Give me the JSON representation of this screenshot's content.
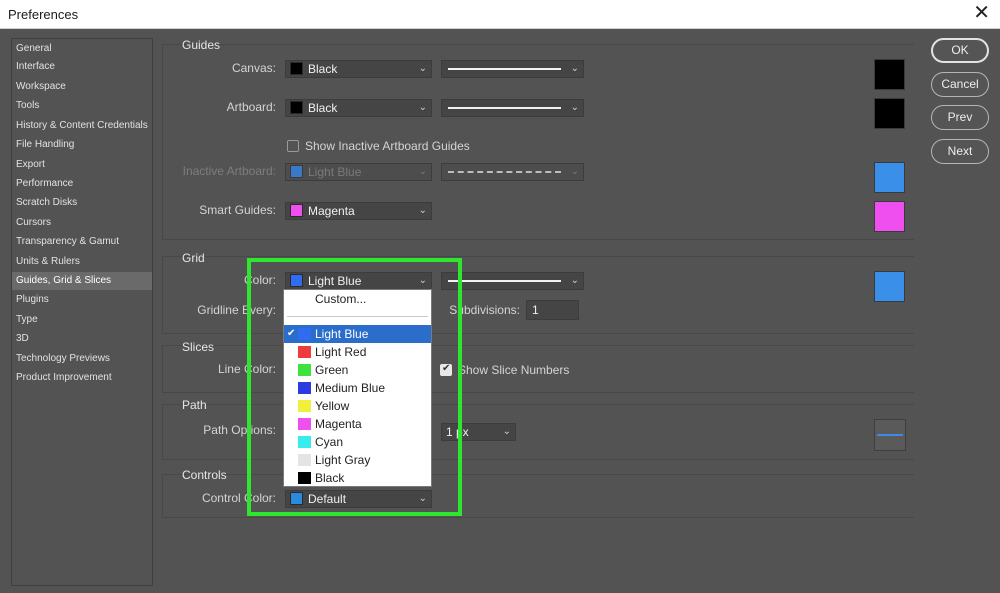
{
  "window": {
    "title": "Preferences",
    "close": "✕"
  },
  "sidebar": {
    "items": [
      {
        "label": "General"
      },
      {
        "label": "Interface"
      },
      {
        "label": "Workspace"
      },
      {
        "label": "Tools"
      },
      {
        "label": "History & Content Credentials"
      },
      {
        "label": "File Handling"
      },
      {
        "label": "Export"
      },
      {
        "label": "Performance"
      },
      {
        "label": "Scratch Disks"
      },
      {
        "label": "Cursors"
      },
      {
        "label": "Transparency & Gamut"
      },
      {
        "label": "Units & Rulers"
      },
      {
        "label": "Guides, Grid & Slices",
        "selected": true
      },
      {
        "label": "Plugins"
      },
      {
        "label": "Type"
      },
      {
        "label": "3D"
      },
      {
        "label": "Technology Previews"
      },
      {
        "label": "Product Improvement"
      }
    ]
  },
  "guides": {
    "title": "Guides",
    "canvas_label": "Canvas:",
    "canvas_color": "Black",
    "canvas_color_hex": "#000000",
    "artboard_label": "Artboard:",
    "artboard_color": "Black",
    "artboard_color_hex": "#000000",
    "show_inactive_label": "Show Inactive Artboard Guides",
    "show_inactive_checked": false,
    "inactive_label": "Inactive Artboard:",
    "inactive_color": "Light Blue",
    "inactive_color_hex": "#3a8fe8",
    "smart_label": "Smart Guides:",
    "smart_color": "Magenta",
    "smart_color_hex": "#f04ff0"
  },
  "grid": {
    "title": "Grid",
    "color_label": "Color:",
    "color_value": "Light Blue",
    "color_hex": "#3a8fe8",
    "gridline_label": "Gridline Every:",
    "subdivisions_label": "Subdivisions:",
    "subdivisions_value": "1"
  },
  "slices": {
    "title": "Slices",
    "line_color_label": "Line Color:",
    "show_numbers_label": "Show Slice Numbers",
    "show_numbers_checked": true
  },
  "path": {
    "title": "Path",
    "options_label": "Path Options:",
    "width_value": "1 px"
  },
  "controls": {
    "title": "Controls",
    "color_label": "Control Color:",
    "color_value": "Default",
    "color_hex": "#2a8ae0"
  },
  "buttons": {
    "ok": "OK",
    "cancel": "Cancel",
    "prev": "Prev",
    "next": "Next"
  },
  "color_dropdown": {
    "custom": "Custom...",
    "options": [
      {
        "label": "Light Blue",
        "hex": "#2f6cf0",
        "selected": true
      },
      {
        "label": "Light Red",
        "hex": "#ee3b3b"
      },
      {
        "label": "Green",
        "hex": "#3ce33c"
      },
      {
        "label": "Medium Blue",
        "hex": "#2c3ae0"
      },
      {
        "label": "Yellow",
        "hex": "#f0ef3a"
      },
      {
        "label": "Magenta",
        "hex": "#f04ff0"
      },
      {
        "label": "Cyan",
        "hex": "#37ecec"
      },
      {
        "label": "Light Gray",
        "hex": "#e4e4e4"
      },
      {
        "label": "Black",
        "hex": "#000000"
      }
    ],
    "check": "✔"
  },
  "highlight_color": "#2ee62e"
}
